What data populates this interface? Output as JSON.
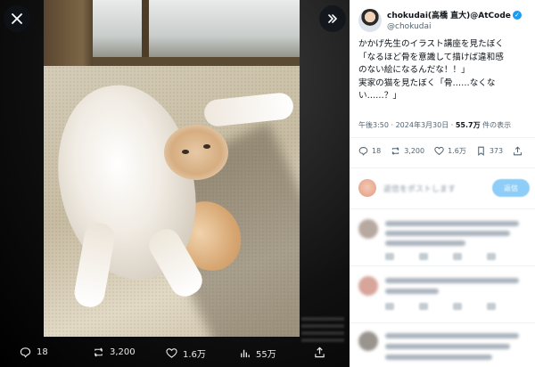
{
  "viewer": {
    "close_icon": "close-icon",
    "expand_icon": "expand-icon",
    "actions": {
      "replies": "18",
      "reposts": "3,200",
      "likes": "1.6万",
      "views": "55万"
    }
  },
  "post": {
    "author_name": "chokudai(高橋 直大)@AtCode",
    "handle": "@chokudai",
    "lines": [
      "かかげ先生のイラスト講座を見たぼく",
      "「なるほど骨を意識して描けば違和感",
      "のない絵になるんだな！！」",
      "実家の猫を見たぼく「骨……なくな",
      "い……？」"
    ],
    "time": "午後3:50 · 2024年3月30日 · ",
    "views_count": "55.7万",
    "views_label": " 件の表示",
    "stats": {
      "replies": "18",
      "reposts": "3,200",
      "likes": "1.6万",
      "bookmarks": "373"
    }
  },
  "reply": {
    "placeholder": "返信をポストします",
    "button": "返信"
  },
  "colors": {
    "accent": "#1d9bf0",
    "text": "#0f1419",
    "muted": "#536471"
  }
}
